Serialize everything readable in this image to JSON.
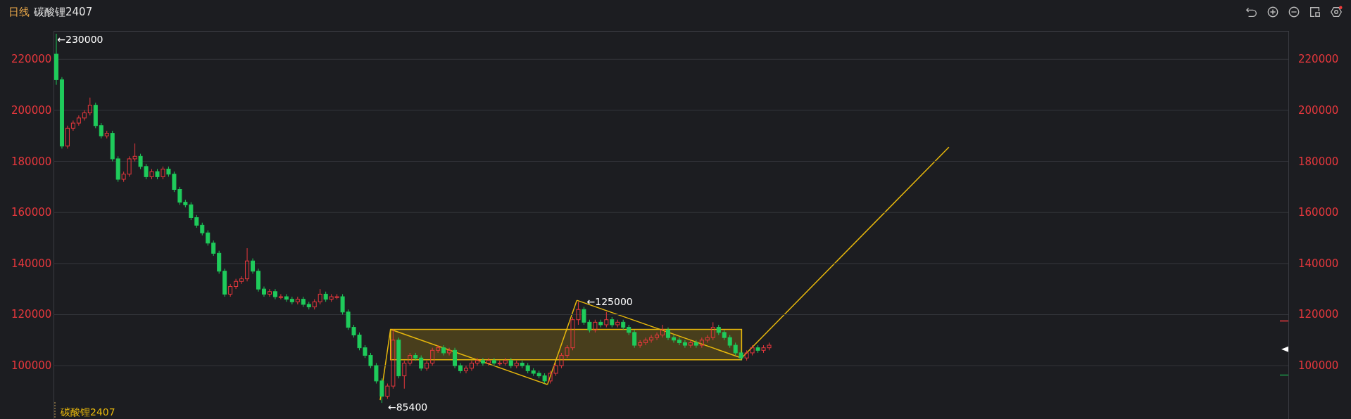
{
  "header": {
    "period": "日线",
    "symbol": "碳酸锂2407"
  },
  "chart": {
    "legend": "碳酸锂2407",
    "chart_data": {
      "type": "candlestick",
      "grid": true,
      "ylim": [
        79100,
        231100
      ],
      "yticks": [
        {
          "value": 100000,
          "label": "100000"
        },
        {
          "value": 120000,
          "label": "120000"
        },
        {
          "value": 140000,
          "label": "140000"
        },
        {
          "value": 160000,
          "label": "160000"
        },
        {
          "value": 180000,
          "label": "180000"
        },
        {
          "value": 200000,
          "label": "200000"
        },
        {
          "value": 220000,
          "label": "220000"
        }
      ],
      "ohlc": [
        [
          222000,
          230000,
          210000,
          212000
        ],
        [
          212000,
          213000,
          185000,
          186000
        ],
        [
          186000,
          194000,
          185000,
          193000
        ],
        [
          193000,
          196000,
          192000,
          195000
        ],
        [
          195000,
          198000,
          194000,
          197000
        ],
        [
          197000,
          200000,
          196000,
          199000
        ],
        [
          199000,
          205000,
          198000,
          202000
        ],
        [
          202000,
          203000,
          193000,
          194000
        ],
        [
          194000,
          195000,
          189000,
          190000
        ],
        [
          190000,
          192000,
          189000,
          191000
        ],
        [
          191000,
          192000,
          180000,
          181000
        ],
        [
          181000,
          182000,
          172000,
          173000
        ],
        [
          173000,
          176000,
          172000,
          175000
        ],
        [
          175000,
          182000,
          174000,
          181000
        ],
        [
          181000,
          187000,
          180000,
          182000
        ],
        [
          182000,
          183000,
          177000,
          178000
        ],
        [
          178000,
          179000,
          173000,
          174000
        ],
        [
          174000,
          177000,
          173000,
          176000
        ],
        [
          176000,
          177000,
          173000,
          174000
        ],
        [
          174000,
          178000,
          173000,
          177000
        ],
        [
          177000,
          178000,
          174000,
          175000
        ],
        [
          175000,
          176000,
          168000,
          169000
        ],
        [
          169000,
          170000,
          163000,
          164000
        ],
        [
          164000,
          165000,
          162000,
          163000
        ],
        [
          163000,
          164000,
          157000,
          158000
        ],
        [
          158000,
          159000,
          154000,
          155000
        ],
        [
          155000,
          156000,
          151000,
          152000
        ],
        [
          152000,
          153000,
          147000,
          148000
        ],
        [
          148000,
          149000,
          143000,
          144000
        ],
        [
          144000,
          145000,
          136000,
          137000
        ],
        [
          137000,
          138000,
          127000,
          128000
        ],
        [
          128000,
          132000,
          127000,
          131000
        ],
        [
          131000,
          134000,
          130000,
          133000
        ],
        [
          133000,
          135000,
          132000,
          134000
        ],
        [
          134000,
          146000,
          133000,
          141000
        ],
        [
          141000,
          142000,
          136000,
          137000
        ],
        [
          137000,
          138000,
          129000,
          130000
        ],
        [
          130000,
          131000,
          127000,
          128000
        ],
        [
          128000,
          130000,
          127000,
          129000
        ],
        [
          129000,
          130000,
          126000,
          127000
        ],
        [
          127000,
          128000,
          126000,
          127000
        ],
        [
          127000,
          128000,
          125000,
          126000
        ],
        [
          126000,
          127000,
          124000,
          125000
        ],
        [
          125000,
          127000,
          124000,
          126000
        ],
        [
          126000,
          127000,
          123000,
          124000
        ],
        [
          124000,
          125000,
          122000,
          123000
        ],
        [
          123000,
          126000,
          122000,
          125000
        ],
        [
          125000,
          130000,
          124000,
          128000
        ],
        [
          128000,
          129000,
          125000,
          126000
        ],
        [
          126000,
          128000,
          125000,
          127000
        ],
        [
          127000,
          128000,
          126000,
          127000
        ],
        [
          127000,
          128000,
          120000,
          121000
        ],
        [
          121000,
          122000,
          114000,
          115000
        ],
        [
          115000,
          116000,
          111000,
          112000
        ],
        [
          112000,
          113000,
          106000,
          107000
        ],
        [
          107000,
          108000,
          103000,
          104000
        ],
        [
          104000,
          105000,
          99000,
          100000
        ],
        [
          100000,
          101000,
          93000,
          94000
        ],
        [
          94000,
          95000,
          85400,
          88000
        ],
        [
          88000,
          93000,
          87000,
          92000
        ],
        [
          92000,
          114200,
          91000,
          110000
        ],
        [
          110000,
          111000,
          95000,
          96000
        ],
        [
          96000,
          102000,
          91000,
          101000
        ],
        [
          101000,
          105000,
          100000,
          104000
        ],
        [
          104000,
          105000,
          102000,
          103000
        ],
        [
          103000,
          104000,
          98000,
          99000
        ],
        [
          99000,
          102000,
          98000,
          101000
        ],
        [
          101000,
          107000,
          100000,
          106000
        ],
        [
          106000,
          108000,
          105000,
          107000
        ],
        [
          107000,
          108000,
          104000,
          105000
        ],
        [
          105000,
          107000,
          104000,
          106000
        ],
        [
          106000,
          107000,
          99000,
          100000
        ],
        [
          100000,
          101000,
          97000,
          98000
        ],
        [
          98000,
          100000,
          97000,
          99000
        ],
        [
          99000,
          102000,
          98000,
          101000
        ],
        [
          101000,
          103000,
          100000,
          102000
        ],
        [
          102000,
          103000,
          100000,
          101000
        ],
        [
          101000,
          103000,
          100000,
          102000
        ],
        [
          102000,
          103000,
          100000,
          101000
        ],
        [
          101000,
          102000,
          100000,
          101000
        ],
        [
          101000,
          103000,
          100000,
          102000
        ],
        [
          102000,
          103000,
          99000,
          100000
        ],
        [
          100000,
          102000,
          99000,
          101000
        ],
        [
          101000,
          102000,
          99000,
          100000
        ],
        [
          100000,
          101000,
          97000,
          98000
        ],
        [
          98000,
          99000,
          96000,
          97000
        ],
        [
          97000,
          98000,
          95000,
          96000
        ],
        [
          96000,
          97000,
          93000,
          94000
        ],
        [
          94000,
          98000,
          93000,
          97000
        ],
        [
          97000,
          101000,
          96000,
          100000
        ],
        [
          100000,
          105000,
          99000,
          104000
        ],
        [
          104000,
          108000,
          103000,
          107000
        ],
        [
          107000,
          119000,
          106000,
          118000
        ],
        [
          118000,
          125000,
          116000,
          122000
        ],
        [
          122000,
          123000,
          116000,
          117000
        ],
        [
          117000,
          118000,
          113000,
          114000
        ],
        [
          114000,
          118000,
          113000,
          117000
        ],
        [
          117000,
          118000,
          115000,
          116000
        ],
        [
          116000,
          121000,
          115000,
          118000
        ],
        [
          118000,
          119000,
          115000,
          116000
        ],
        [
          116000,
          118000,
          115000,
          117000
        ],
        [
          117000,
          118000,
          114000,
          115000
        ],
        [
          115000,
          116000,
          112000,
          113000
        ],
        [
          113000,
          114000,
          107000,
          108000
        ],
        [
          108000,
          110000,
          107000,
          109000
        ],
        [
          109000,
          111000,
          108000,
          110000
        ],
        [
          110000,
          112000,
          109000,
          111000
        ],
        [
          111000,
          113000,
          110000,
          112000
        ],
        [
          112000,
          116000,
          111000,
          114000
        ],
        [
          114000,
          115000,
          110000,
          111000
        ],
        [
          111000,
          112000,
          109000,
          110000
        ],
        [
          110000,
          111000,
          108000,
          109000
        ],
        [
          109000,
          110000,
          107000,
          108000
        ],
        [
          108000,
          110000,
          107000,
          109000
        ],
        [
          109000,
          110000,
          107000,
          108000
        ],
        [
          108000,
          111000,
          107000,
          110000
        ],
        [
          110000,
          112000,
          109000,
          111000
        ],
        [
          111000,
          117000,
          110000,
          115000
        ],
        [
          115000,
          116000,
          112000,
          113000
        ],
        [
          113000,
          114000,
          110000,
          111000
        ],
        [
          111000,
          112000,
          107000,
          108000
        ],
        [
          108000,
          109000,
          104000,
          105000
        ],
        [
          105000,
          106000,
          102000,
          103000
        ],
        [
          103000,
          106000,
          102000,
          105000
        ],
        [
          105000,
          108000,
          104000,
          107000
        ],
        [
          107000,
          108000,
          105000,
          106000
        ],
        [
          106000,
          108000,
          105000,
          107000
        ],
        [
          107000,
          109000,
          106000,
          108000
        ],
        null,
        null,
        null,
        null,
        null,
        null,
        null,
        null,
        null,
        null,
        null,
        null,
        null,
        null,
        null,
        null,
        null,
        null,
        null,
        null,
        null,
        null,
        null,
        null,
        null,
        null,
        null,
        null,
        null,
        null,
        null,
        null,
        null,
        null,
        null,
        null,
        null,
        null,
        null,
        null,
        null,
        null,
        null,
        null,
        null,
        null,
        null,
        null,
        null,
        null,
        null,
        null,
        null,
        null,
        null,
        null,
        null,
        null,
        null,
        null,
        null,
        null,
        null,
        null,
        null,
        null,
        null,
        null,
        null,
        null,
        null,
        null,
        null,
        null,
        null,
        null,
        null,
        null,
        null,
        null,
        null,
        null,
        null,
        null,
        null,
        null,
        null,
        null,
        null,
        null,
        null,
        null
      ],
      "annotations": [
        "←230000",
        "←125000",
        "←85400"
      ]
    }
  }
}
